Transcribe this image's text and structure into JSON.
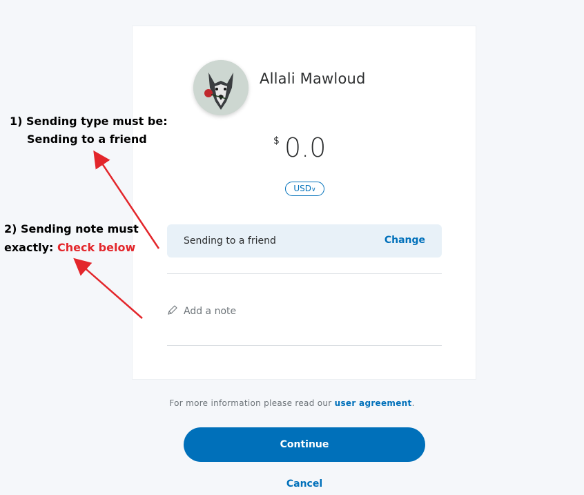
{
  "recipient": {
    "name": "Allali Mawloud",
    "avatar_icon": "wolf-portrait-avatar"
  },
  "amount": {
    "symbol": "$",
    "value": "0.0"
  },
  "currency": {
    "selected": "USD"
  },
  "sending_type": {
    "label": "Sending to a friend",
    "change_label": "Change"
  },
  "note": {
    "placeholder": "Add a note",
    "icon": "pencil-icon"
  },
  "footer": {
    "agreement_prefix": "For more information please read our ",
    "agreement_link": "user agreement",
    "agreement_suffix": ".",
    "continue_label": "Continue",
    "cancel_label": "Cancel"
  },
  "annotations": {
    "first": {
      "line1": "1) Sending type must be:",
      "line2": "Sending to a friend"
    },
    "second": {
      "line1": "2) Sending note must",
      "line2_prefix": "exactly: ",
      "line2_highlight": "Check below"
    }
  },
  "colors": {
    "accent": "#0070ba",
    "annotation_red": "#e3262b",
    "type_box": "#e8f1f8",
    "background": "#f5f7fa"
  }
}
